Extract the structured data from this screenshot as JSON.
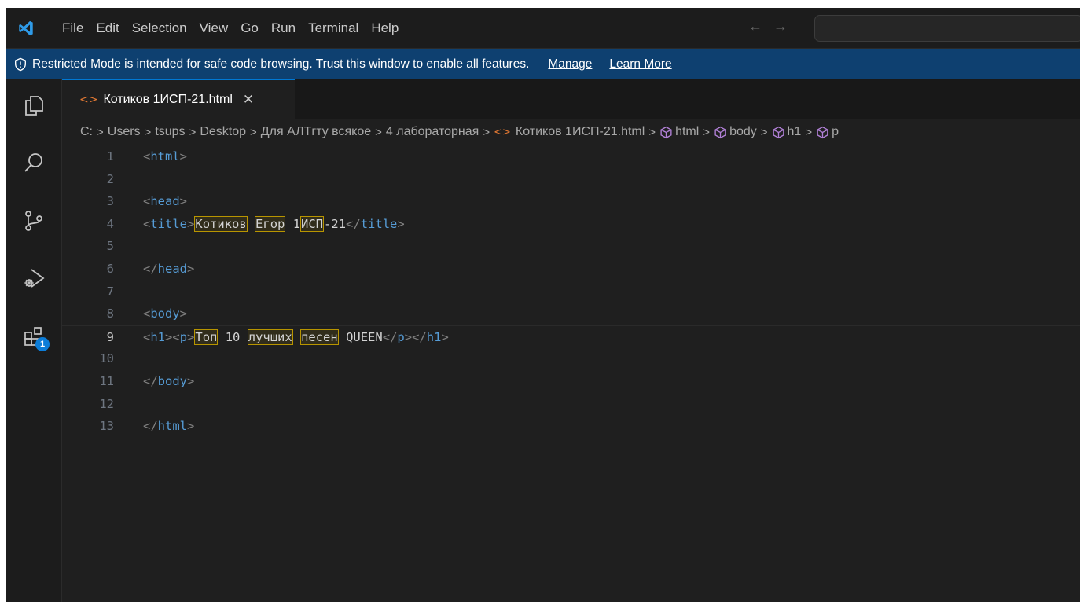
{
  "menu": [
    "File",
    "Edit",
    "Selection",
    "View",
    "Go",
    "Run",
    "Terminal",
    "Help"
  ],
  "nav": {
    "back": "←",
    "forward": "→"
  },
  "banner": {
    "message": "Restricted Mode is intended for safe code browsing. Trust this window to enable all features.",
    "manage": "Manage",
    "learn_more": "Learn More"
  },
  "activity": {
    "extensions_badge": "1"
  },
  "tab": {
    "label": "Котиков 1ИСП-21.html",
    "close": "✕"
  },
  "breadcrumb": {
    "items": [
      "C:",
      "Users",
      "tsups",
      "Desktop",
      "Для АЛТгту всякое",
      "4 лабораторная",
      "Котиков 1ИСП-21.html",
      "html",
      "body",
      "h1",
      "p"
    ]
  },
  "editor": {
    "current_line": 9,
    "lines": [
      {
        "n": "1",
        "code": "<html>"
      },
      {
        "n": "2",
        "code": ""
      },
      {
        "n": "3",
        "code": "<head>"
      },
      {
        "n": "4",
        "code": "<title>Котиков Егор 1ИСП-21</title>"
      },
      {
        "n": "5",
        "code": ""
      },
      {
        "n": "6",
        "code": "</head>"
      },
      {
        "n": "7",
        "code": ""
      },
      {
        "n": "8",
        "code": "<body>"
      },
      {
        "n": "9",
        "code": "<h1><p>Топ 10 лучших песен QUEEN</p></h1>"
      },
      {
        "n": "10",
        "code": ""
      },
      {
        "n": "11",
        "code": "</body>"
      },
      {
        "n": "12",
        "code": ""
      },
      {
        "n": "13",
        "code": "</html>"
      }
    ]
  },
  "colors": {
    "accent": "#0078d4",
    "banner": "#0e4070",
    "tag": "#569cd6",
    "file_icon": "#e37933",
    "badge": "#0c7dd8"
  }
}
